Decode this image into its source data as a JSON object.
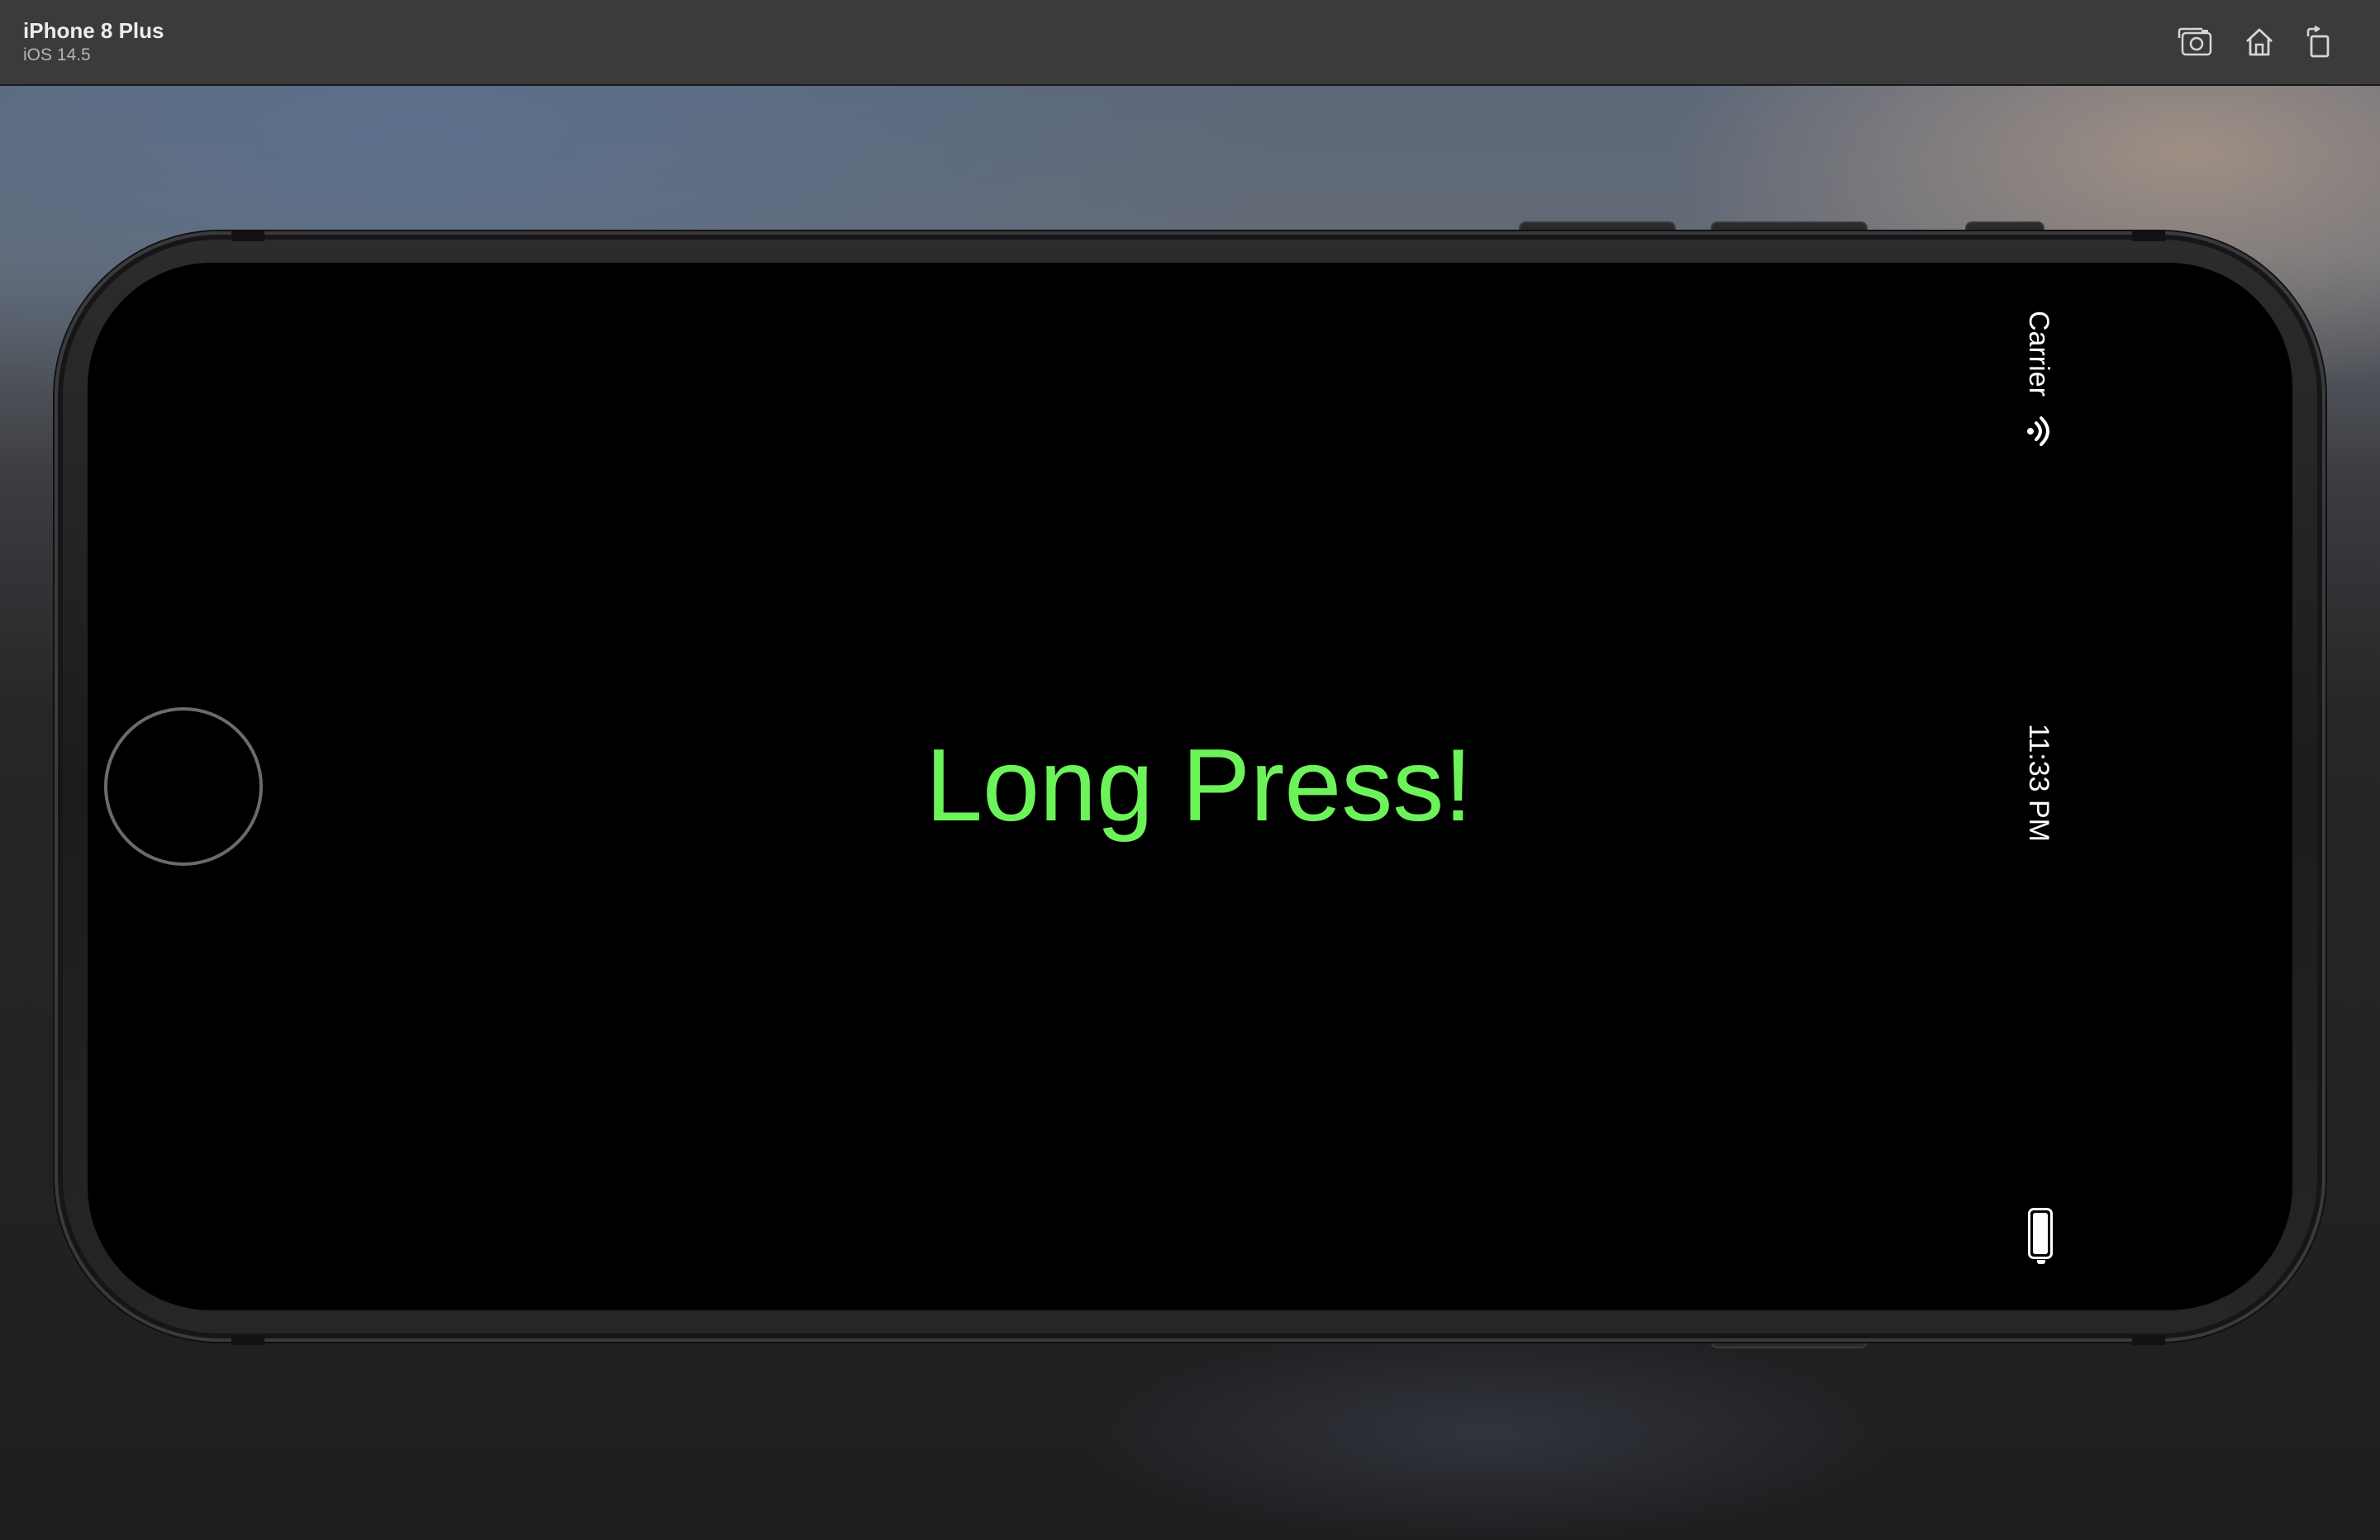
{
  "window": {
    "device_name": "iPhone 8 Plus",
    "os_version": "iOS 14.5"
  },
  "toolbar": {
    "buttons": [
      {
        "name": "screenshot",
        "icon": "camera-icon"
      },
      {
        "name": "home",
        "icon": "home-icon"
      },
      {
        "name": "rotate",
        "icon": "rotate-icon"
      }
    ]
  },
  "status_bar": {
    "carrier": "Carrier",
    "time": "11:33 PM",
    "wifi_icon": "wifi-icon",
    "battery_icon": "battery-icon",
    "battery_level": 1.0
  },
  "app": {
    "label": "Long Press!",
    "label_color": "#6df35a",
    "background": "#000000"
  },
  "colors": {
    "titlebar": "#3b3b3b",
    "device_frame": "#1c1c1e"
  }
}
